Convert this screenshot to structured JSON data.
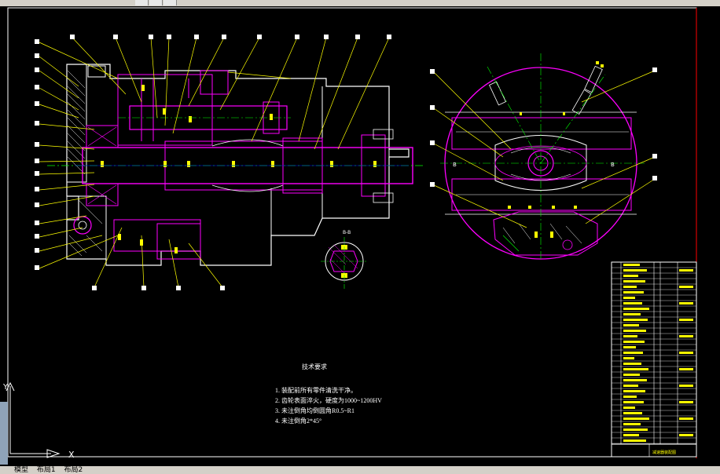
{
  "drawing": {
    "section_label": "B-B",
    "datum_mark": "B",
    "notes_title": "技术要求",
    "notes": [
      "1. 装配前所有零件清洗干净。",
      "2. 齿轮表面淬火，硬度为1000~1200HV",
      "3. 未注倒角均倒圆角R0.5~R1",
      "4. 未注倒角2*45°"
    ],
    "title_block_name": "减速器装配图",
    "ucs": {
      "y": "Y",
      "x": "X"
    }
  },
  "statusbar": {
    "tabs": [
      "模型",
      "布局1",
      "布局2"
    ]
  },
  "colors": {
    "background": "#000000",
    "leader": "#ffff00",
    "outline": "#ffffff",
    "part": "#ff00ff",
    "centerline": "#00ff00",
    "axis": "#0000ff",
    "border": "#ff0000"
  }
}
